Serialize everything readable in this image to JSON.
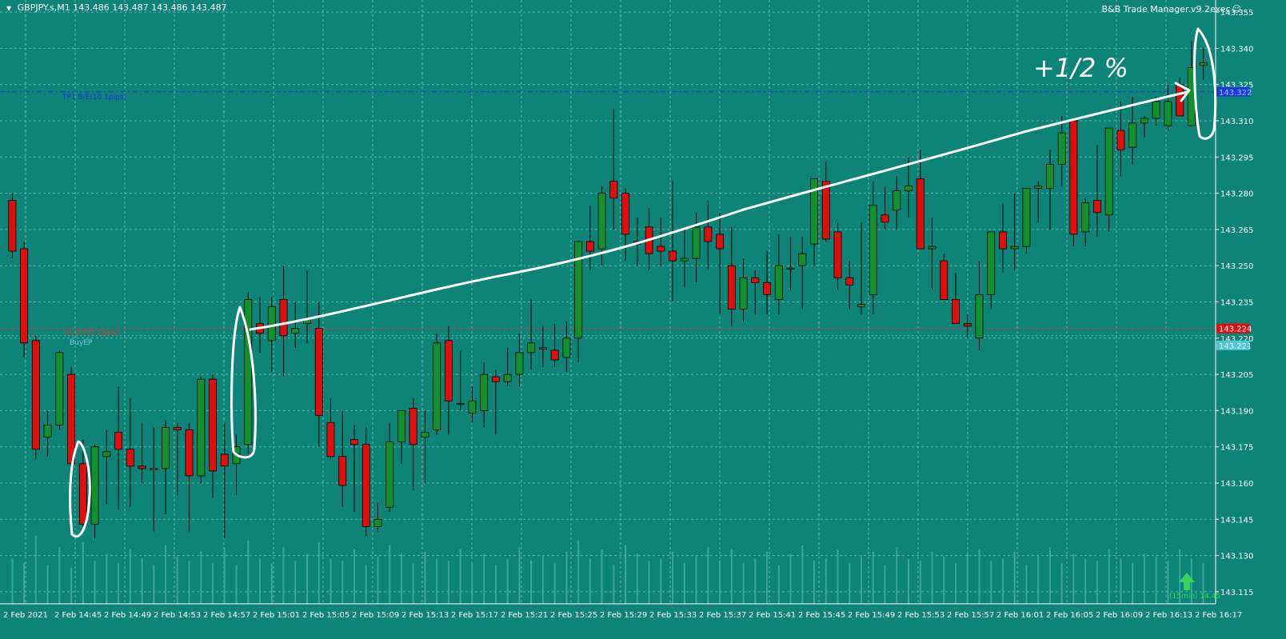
{
  "header": {
    "symbol": "GBPJPY.s,M1",
    "ohlc": "143.486 143.487 143.486 143.487",
    "expert": "B&B Trade Manager.v9.2exec",
    "expert_icon": "smiley-icon"
  },
  "colors": {
    "background": "#0e8479",
    "grid": "#5fb3aa",
    "bull": "#13902e",
    "bear": "#e10e0e",
    "candle_outline": "#000000",
    "volume": "#3aa69a",
    "tp_line": "#1d39d6",
    "sl_line": "#d63a3a",
    "buy_entry": "#6ccfe0",
    "annotation": "#ffffff",
    "price_tag_current": "#e10e0e",
    "arrow": "#36d45a"
  },
  "levels": {
    "tp_label": "TP1 B/E(10.1pips)",
    "tp_price": "143.322",
    "sl_label": "SL 0.0(0.1pips)",
    "sl_price": "143.224",
    "buy_label": "BuyEP",
    "buy_price": "143.221"
  },
  "annotation_text": "+1/2 %",
  "corner_label": "(15min) 14.45",
  "arrow_icon": "up-arrow-icon",
  "chart_data": {
    "type": "candlestick",
    "ylim": [
      143.11,
      143.36
    ],
    "yticks": [
      "143.355",
      "143.340",
      "143.325",
      "143.310",
      "143.295",
      "143.280",
      "143.265",
      "143.250",
      "143.235",
      "143.220",
      "143.205",
      "143.190",
      "143.175",
      "143.160",
      "143.145",
      "143.130",
      "143.115"
    ],
    "xticks": [
      "2 Feb 2021",
      "2 Feb 14:45",
      "2 Feb 14:49",
      "2 Feb 14:53",
      "2 Feb 14:57",
      "2 Feb 15:01",
      "2 Feb 15:05",
      "2 Feb 15:09",
      "2 Feb 15:13",
      "2 Feb 15:17",
      "2 Feb 15:21",
      "2 Feb 15:25",
      "2 Feb 15:29",
      "2 Feb 15:33",
      "2 Feb 15:37",
      "2 Feb 15:41",
      "2 Feb 15:45",
      "2 Feb 15:49",
      "2 Feb 15:53",
      "2 Feb 15:57",
      "2 Feb 16:01",
      "2 Feb 16:05",
      "2 Feb 16:09",
      "2 Feb 16:13",
      "2 Feb 16:17"
    ],
    "candles": [
      [
        143.277,
        143.28,
        143.253,
        143.256
      ],
      [
        143.257,
        143.26,
        143.212,
        143.218
      ],
      [
        143.219,
        143.221,
        143.17,
        143.174
      ],
      [
        143.179,
        143.19,
        143.171,
        143.184
      ],
      [
        143.184,
        143.215,
        143.182,
        143.214
      ],
      [
        143.205,
        143.208,
        143.162,
        143.168
      ],
      [
        143.168,
        143.178,
        143.142,
        143.143
      ],
      [
        143.143,
        143.176,
        143.137,
        143.175
      ],
      [
        143.171,
        143.182,
        143.151,
        143.173
      ],
      [
        143.181,
        143.2,
        143.149,
        143.174
      ],
      [
        143.174,
        143.195,
        143.15,
        143.167
      ],
      [
        143.167,
        143.185,
        143.16,
        143.166
      ],
      [
        143.166,
        143.183,
        143.14,
        143.166
      ],
      [
        143.166,
        143.186,
        143.147,
        143.183
      ],
      [
        143.183,
        143.185,
        143.155,
        143.182
      ],
      [
        143.182,
        143.185,
        143.14,
        143.163
      ],
      [
        143.163,
        143.204,
        143.16,
        143.203
      ],
      [
        143.203,
        143.205,
        143.154,
        143.165
      ],
      [
        143.172,
        143.185,
        143.137,
        143.167
      ],
      [
        143.168,
        143.18,
        143.155,
        143.175
      ],
      [
        143.176,
        143.239,
        143.172,
        143.236
      ],
      [
        143.226,
        143.237,
        143.214,
        143.222
      ],
      [
        143.219,
        143.237,
        143.206,
        143.233
      ],
      [
        143.236,
        143.25,
        143.204,
        143.221
      ],
      [
        143.222,
        143.235,
        143.216,
        143.224
      ],
      [
        143.226,
        143.248,
        143.218,
        143.228
      ],
      [
        143.224,
        143.235,
        143.175,
        143.188
      ],
      [
        143.185,
        143.195,
        143.17,
        143.171
      ],
      [
        143.171,
        143.19,
        143.15,
        143.159
      ],
      [
        143.178,
        143.184,
        143.148,
        143.176
      ],
      [
        143.176,
        143.183,
        143.138,
        143.142
      ],
      [
        143.142,
        143.152,
        143.14,
        143.145
      ],
      [
        143.15,
        143.185,
        143.148,
        143.177
      ],
      [
        143.177,
        143.19,
        143.168,
        143.19
      ],
      [
        143.191,
        143.195,
        143.157,
        143.176
      ],
      [
        143.179,
        143.19,
        143.16,
        143.181
      ],
      [
        143.182,
        143.222,
        143.18,
        143.218
      ],
      [
        143.219,
        143.225,
        143.18,
        143.194
      ],
      [
        143.193,
        143.215,
        143.19,
        143.193
      ],
      [
        143.189,
        143.2,
        143.185,
        143.194
      ],
      [
        143.19,
        143.21,
        143.183,
        143.205
      ],
      [
        143.204,
        143.207,
        143.18,
        143.202
      ],
      [
        143.202,
        143.216,
        143.2,
        143.205
      ],
      [
        143.205,
        143.222,
        143.2,
        143.214
      ],
      [
        143.214,
        143.236,
        143.207,
        143.218
      ],
      [
        143.216,
        143.225,
        143.208,
        143.216
      ],
      [
        143.215,
        143.226,
        143.208,
        143.211
      ],
      [
        143.212,
        143.227,
        143.206,
        143.22
      ],
      [
        143.22,
        143.245,
        143.21,
        143.26
      ],
      [
        143.26,
        143.275,
        143.248,
        143.256
      ],
      [
        143.257,
        143.283,
        143.25,
        143.28
      ],
      [
        143.285,
        143.315,
        143.265,
        143.278
      ],
      [
        143.28,
        143.282,
        143.252,
        143.263
      ],
      [
        143.26,
        143.27,
        143.25,
        143.259
      ],
      [
        143.266,
        143.274,
        143.248,
        143.255
      ],
      [
        143.258,
        143.27,
        143.25,
        143.256
      ],
      [
        143.256,
        143.285,
        143.235,
        143.252
      ],
      [
        143.252,
        143.265,
        143.241,
        143.253
      ],
      [
        143.253,
        143.272,
        143.243,
        143.266
      ],
      [
        143.266,
        143.277,
        143.248,
        143.26
      ],
      [
        143.263,
        143.272,
        143.23,
        143.257
      ],
      [
        143.25,
        143.266,
        143.225,
        143.232
      ],
      [
        143.232,
        143.253,
        143.227,
        143.245
      ],
      [
        143.245,
        143.248,
        143.23,
        143.243
      ],
      [
        143.243,
        143.256,
        143.23,
        143.238
      ],
      [
        143.236,
        143.263,
        143.23,
        143.25
      ],
      [
        143.249,
        143.262,
        143.24,
        143.249
      ],
      [
        143.25,
        143.262,
        143.232,
        143.255
      ],
      [
        143.259,
        143.285,
        143.25,
        143.286
      ],
      [
        143.285,
        143.293,
        143.26,
        143.261
      ],
      [
        143.264,
        143.268,
        143.24,
        143.245
      ],
      [
        143.245,
        143.252,
        143.232,
        143.242
      ],
      [
        143.233,
        143.268,
        143.23,
        143.234
      ],
      [
        143.238,
        143.285,
        143.23,
        143.275
      ],
      [
        143.271,
        143.283,
        143.265,
        143.268
      ],
      [
        143.273,
        143.287,
        143.265,
        143.281
      ],
      [
        143.281,
        143.295,
        143.27,
        143.283
      ],
      [
        143.286,
        143.298,
        143.258,
        143.257
      ],
      [
        143.257,
        143.27,
        143.24,
        143.258
      ],
      [
        143.252,
        143.255,
        143.24,
        143.236
      ],
      [
        143.236,
        143.247,
        143.228,
        143.226
      ],
      [
        143.226,
        143.23,
        143.22,
        143.225
      ],
      [
        143.22,
        143.252,
        143.215,
        143.238
      ],
      [
        143.238,
        143.263,
        143.232,
        143.264
      ],
      [
        143.264,
        143.276,
        143.247,
        143.257
      ],
      [
        143.257,
        143.28,
        143.248,
        143.258
      ],
      [
        143.258,
        143.282,
        143.255,
        143.282
      ],
      [
        143.282,
        143.285,
        143.268,
        143.283
      ],
      [
        143.282,
        143.298,
        143.265,
        143.292
      ],
      [
        143.292,
        143.312,
        143.283,
        143.305
      ],
      [
        143.31,
        143.307,
        143.258,
        143.263
      ],
      [
        143.264,
        143.278,
        143.258,
        143.276
      ],
      [
        143.277,
        143.3,
        143.262,
        143.272
      ],
      [
        143.271,
        143.298,
        143.264,
        143.307
      ],
      [
        143.306,
        143.318,
        143.287,
        143.298
      ],
      [
        143.299,
        143.32,
        143.292,
        143.309
      ],
      [
        143.309,
        143.312,
        143.303,
        143.311
      ],
      [
        143.311,
        143.32,
        143.308,
        143.318
      ],
      [
        143.308,
        143.325,
        143.306,
        143.318
      ],
      [
        143.325,
        143.328,
        143.312,
        143.312
      ],
      [
        143.308,
        143.343,
        143.308,
        143.332
      ],
      [
        143.333,
        143.34,
        143.327,
        143.334
      ]
    ],
    "volumes": [
      20,
      18,
      30,
      17,
      25,
      16,
      27,
      19,
      22,
      18,
      24,
      20,
      17,
      26,
      21,
      19,
      23,
      18,
      25,
      17,
      28,
      20,
      18,
      25,
      19,
      22,
      27,
      20,
      19,
      24,
      17,
      21,
      26,
      22,
      18,
      23,
      20,
      19,
      24,
      18,
      22,
      17,
      20,
      25,
      19,
      21,
      18,
      23,
      28,
      20,
      24,
      17,
      26,
      22,
      19,
      20,
      23,
      18,
      21,
      25,
      19,
      24,
      18,
      20,
      23,
      17,
      22,
      26,
      19,
      20,
      24,
      18,
      21,
      23,
      17,
      25,
      20,
      19,
      23,
      21,
      18,
      22,
      24,
      19,
      20,
      23,
      17,
      21,
      25,
      18,
      22,
      20,
      19,
      24,
      20,
      18,
      22,
      21,
      19,
      24,
      20,
      18
    ]
  }
}
